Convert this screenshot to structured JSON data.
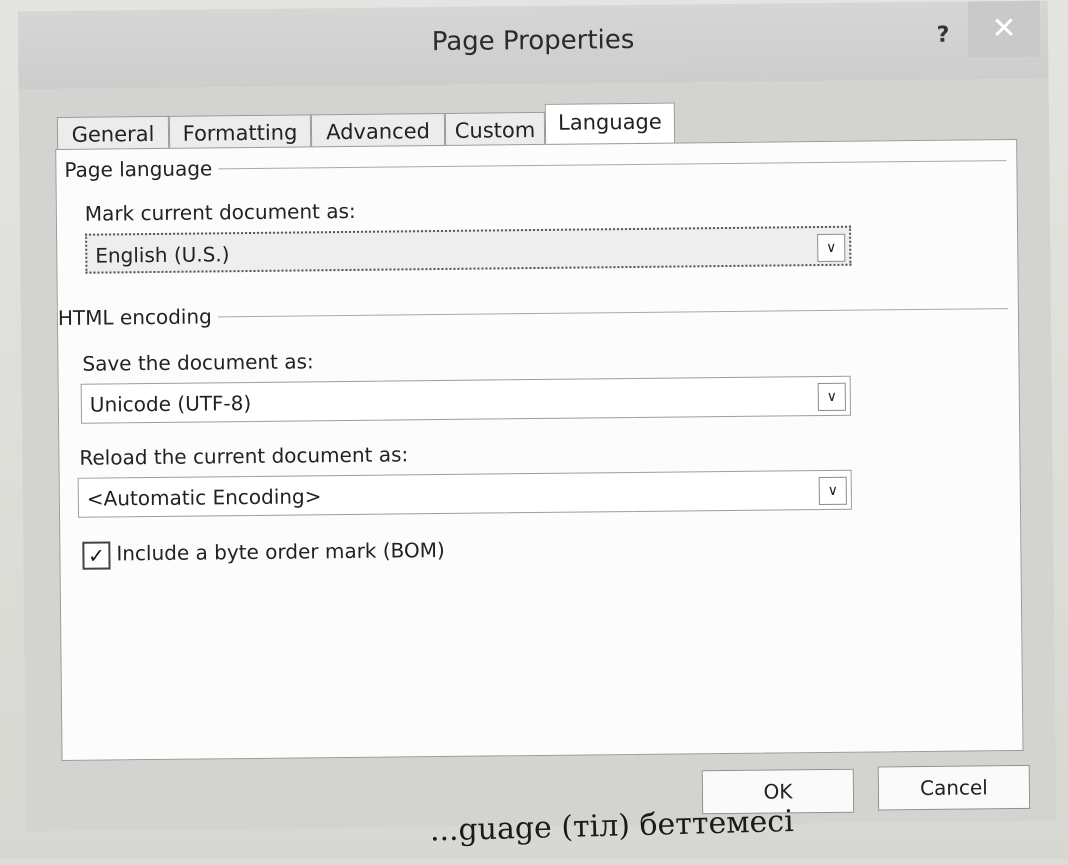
{
  "dialog": {
    "title": "Page Properties",
    "help_label": "?",
    "close_label": "✕"
  },
  "tabs": [
    {
      "label": "General"
    },
    {
      "label": "Formatting"
    },
    {
      "label": "Advanced"
    },
    {
      "label": "Custom"
    },
    {
      "label": "Language"
    }
  ],
  "active_tab": "Language",
  "page_language": {
    "group_label": "Page language",
    "mark_label": "Mark current document as:",
    "mark_value": "English (U.S.)"
  },
  "html_encoding": {
    "group_label": "HTML encoding",
    "save_label": "Save the document as:",
    "save_value": "Unicode (UTF-8)",
    "reload_label": "Reload the current document as:",
    "reload_value": "<Automatic Encoding>",
    "bom_label": "Include a byte order mark (BOM)",
    "bom_checked": true
  },
  "buttons": {
    "ok_label": "OK",
    "cancel_label": "Cancel"
  },
  "icons": {
    "dropdown": "chevron-down-icon",
    "check": "check-icon"
  },
  "caption": "...guage (тіл) беттемесі"
}
